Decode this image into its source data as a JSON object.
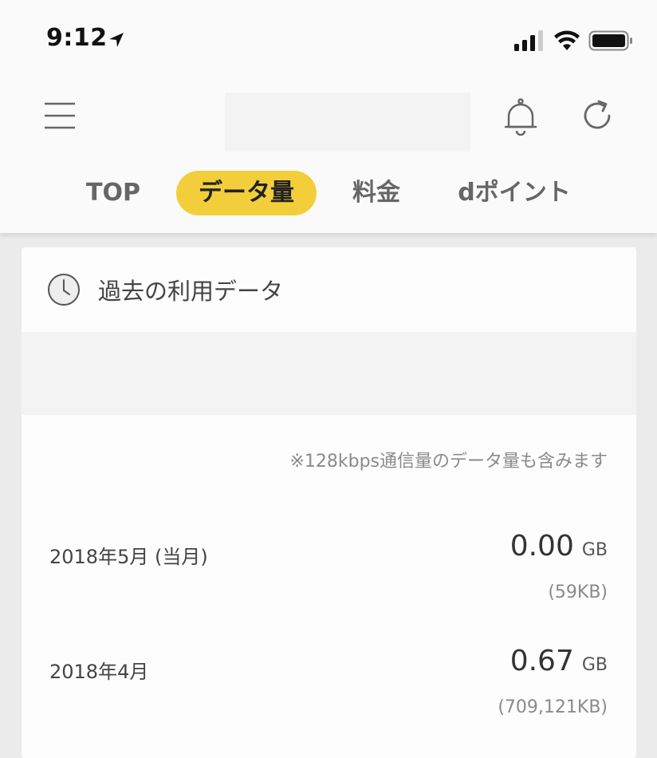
{
  "status_bar": {
    "time": "9:12"
  },
  "tabs": [
    {
      "label": "TOP",
      "active": false
    },
    {
      "label": "データ量",
      "active": true
    },
    {
      "label": "料金",
      "active": false
    },
    {
      "label": "dポイント",
      "active": false
    }
  ],
  "card": {
    "title": "過去の利用データ",
    "note": "※128kbps通信量のデータ量も含みます",
    "rows": [
      {
        "label": "2018年5月 (当月)",
        "value": "0.00",
        "unit": "GB",
        "kb": "(59KB)"
      },
      {
        "label": "2018年4月",
        "value": "0.67",
        "unit": "GB",
        "kb": "(709,121KB)"
      }
    ]
  },
  "colors": {
    "accent": "#f2cf3a",
    "page_background": "#ebebeb",
    "header_background": "#fafafa",
    "card_background": "#fdfdfd"
  },
  "icons": {
    "status": [
      "location-arrow-icon",
      "cellular-signal-icon",
      "wifi-icon",
      "battery-icon"
    ],
    "header": [
      "hamburger-menu-icon",
      "bell-icon",
      "refresh-icon"
    ],
    "card": "clock-icon"
  }
}
